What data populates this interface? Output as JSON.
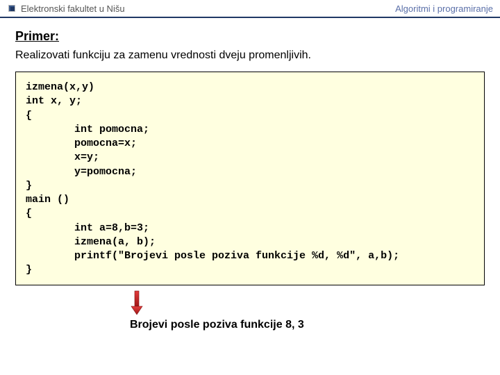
{
  "header": {
    "left": "Elektronski fakultet u Nišu",
    "right": "Algoritmi i programiranje"
  },
  "section_title": "Primer:",
  "description": "Realizovati funkciju za zamenu vrednosti dveju promenljivih.",
  "code": {
    "l1": "izmena(x,y)",
    "l2": "int x, y;",
    "l3": "{",
    "l4": "int pomocna;",
    "l5": "pomocna=x;",
    "l6": "x=y;",
    "l7": "y=pomocna;",
    "l8": "}",
    "l9": "main ()",
    "l10": "{",
    "l11": "int a=8,b=3;",
    "l12": "izmena(a, b);",
    "l13": "printf(\"Brojevi posle poziva funkcije %d, %d\", a,b);",
    "l14": "}"
  },
  "output": "Brojevi posle poziva funkcije 8, 3"
}
